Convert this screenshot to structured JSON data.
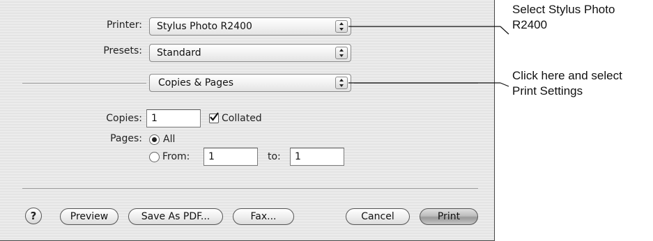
{
  "printer": {
    "label": "Printer:",
    "value": "Stylus Photo R2400"
  },
  "presets": {
    "label": "Presets:",
    "value": "Standard"
  },
  "panel": {
    "value": "Copies & Pages"
  },
  "copies": {
    "label": "Copies:",
    "value": "1",
    "collated_label": "Collated",
    "collated_checked": true
  },
  "pages": {
    "label": "Pages:",
    "all_label": "All",
    "all_selected": true,
    "from_label": "From:",
    "from_value": "1",
    "to_label": "to:",
    "to_value": "1"
  },
  "buttons": {
    "help": "?",
    "preview": "Preview",
    "save_pdf": "Save As PDF...",
    "fax": "Fax...",
    "cancel": "Cancel",
    "print": "Print"
  },
  "callouts": {
    "printer_line1": "Select Stylus Photo",
    "printer_line2": "R2400",
    "panel_line1": "Click here and select",
    "panel_line2": "Print Settings"
  },
  "icons": [
    "popup-arrows-icon",
    "checkmark-icon",
    "radio-dot-icon",
    "help-icon"
  ]
}
